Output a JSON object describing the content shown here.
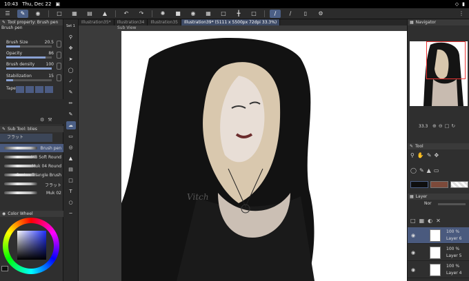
{
  "status": {
    "time": "10:43",
    "date": "Thu, Dec 22",
    "battery": "▮"
  },
  "tabs": [
    {
      "label": "Illustration35*"
    },
    {
      "label": "Illustration34"
    },
    {
      "label": "Illustration35"
    },
    {
      "label": "Illustration39* (5111 x 5500px 72dpi 33.3%)"
    }
  ],
  "subview": {
    "label": "Sub View"
  },
  "tool_property": {
    "title": "Tool property: Brush pen",
    "brush_name": "Brush pen",
    "brush_size_label": "Brush Size",
    "brush_size_value": "20.5",
    "brush_size_level": 0.3,
    "opacity_label": "Opacity",
    "opacity_value": "86",
    "opacity_level": 0.86,
    "density_label": "Brush density",
    "density_value": "100",
    "density_level": 1.0,
    "stabilization_label": "Stabilization",
    "stabilization_value": "15",
    "stabilization_level": 0.15,
    "taper_label": "Taper"
  },
  "sub_tool": {
    "title": "Sub Tool: blies",
    "group_label": "フラット",
    "brushes": [
      {
        "name": "Brush pen"
      },
      {
        "name": "MB Soft Round"
      },
      {
        "name": "Muk 04 Round"
      },
      {
        "name": "Pentax Triangle Brush"
      },
      {
        "name": "フラット"
      },
      {
        "name": "Muk 02"
      }
    ]
  },
  "color_wheel": {
    "title": "Color Wheel"
  },
  "navigator": {
    "title": "Navigator",
    "zoom": "33.3"
  },
  "tool_panel": {
    "title": "Tool"
  },
  "layer_panel": {
    "title": "Layer",
    "blend": "Nor",
    "layers": [
      {
        "pct": "100 %",
        "name": "Layer 6",
        "selected": true
      },
      {
        "pct": "100 %",
        "name": "Layer 5",
        "selected": false
      },
      {
        "pct": "100 %",
        "name": "Layer 4",
        "selected": false
      }
    ]
  },
  "colors": {
    "accent": "#4b5f86",
    "main_color": "#121212",
    "sub_color": "#7c4a3a"
  },
  "signature_text": "Vitch"
}
